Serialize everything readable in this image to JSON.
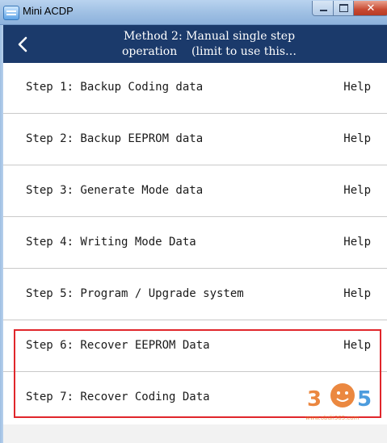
{
  "window": {
    "title": "Mini ACDP",
    "icons": {
      "app": "app-icon",
      "minimize": "minimize-icon",
      "maximize": "maximize-icon",
      "close": "close-icon"
    }
  },
  "header": {
    "title_line1": "Method 2: Manual single step",
    "title_line2": "operation    (limit to use this…",
    "back_icon": "chevron-left-icon",
    "background": "#1b3a6b"
  },
  "steps": [
    {
      "label": "Step 1: Backup Coding data",
      "help": "Help"
    },
    {
      "label": "Step 2: Backup EEPROM data",
      "help": "Help"
    },
    {
      "label": "Step 3: Generate Mode data",
      "help": "Help"
    },
    {
      "label": "Step 4: Writing Mode Data",
      "help": "Help"
    },
    {
      "label": "Step 5: Program / Upgrade system",
      "help": "Help"
    },
    {
      "label": "Step 6: Recover EEPROM Data",
      "help": "Help"
    },
    {
      "label": "Step 7: Recover Coding Data",
      "help": ""
    }
  ],
  "highlight_color": "#e0262b",
  "watermark": {
    "text": "305",
    "url_text": "www.obdii365.com",
    "colors": [
      "#e8731f",
      "#2e8bd8"
    ]
  }
}
